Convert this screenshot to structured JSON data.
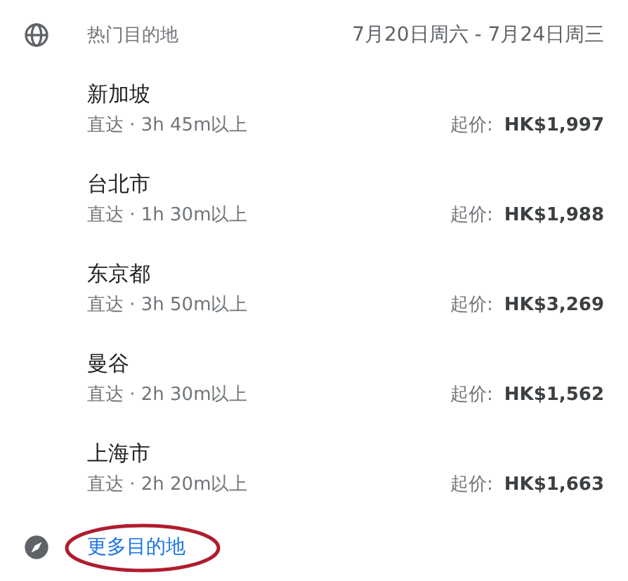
{
  "header": {
    "title": "热门目的地",
    "dates": "7月20日周六 - 7月24日周三"
  },
  "destinations": [
    {
      "name": "新加坡",
      "details": "直达 · 3h 45m以上",
      "price_label": "起价:",
      "price": "HK$1,997"
    },
    {
      "name": "台北市",
      "details": "直达 · 1h 30m以上",
      "price_label": "起价:",
      "price": "HK$1,988"
    },
    {
      "name": "东京都",
      "details": "直达 · 3h 50m以上",
      "price_label": "起价:",
      "price": "HK$3,269"
    },
    {
      "name": "曼谷",
      "details": "直达 · 2h 30m以上",
      "price_label": "起价:",
      "price": "HK$1,562"
    },
    {
      "name": "上海市",
      "details": "直达 · 2h 20m以上",
      "price_label": "起价:",
      "price": "HK$1,663"
    }
  ],
  "footer": {
    "link": "更多目的地"
  }
}
